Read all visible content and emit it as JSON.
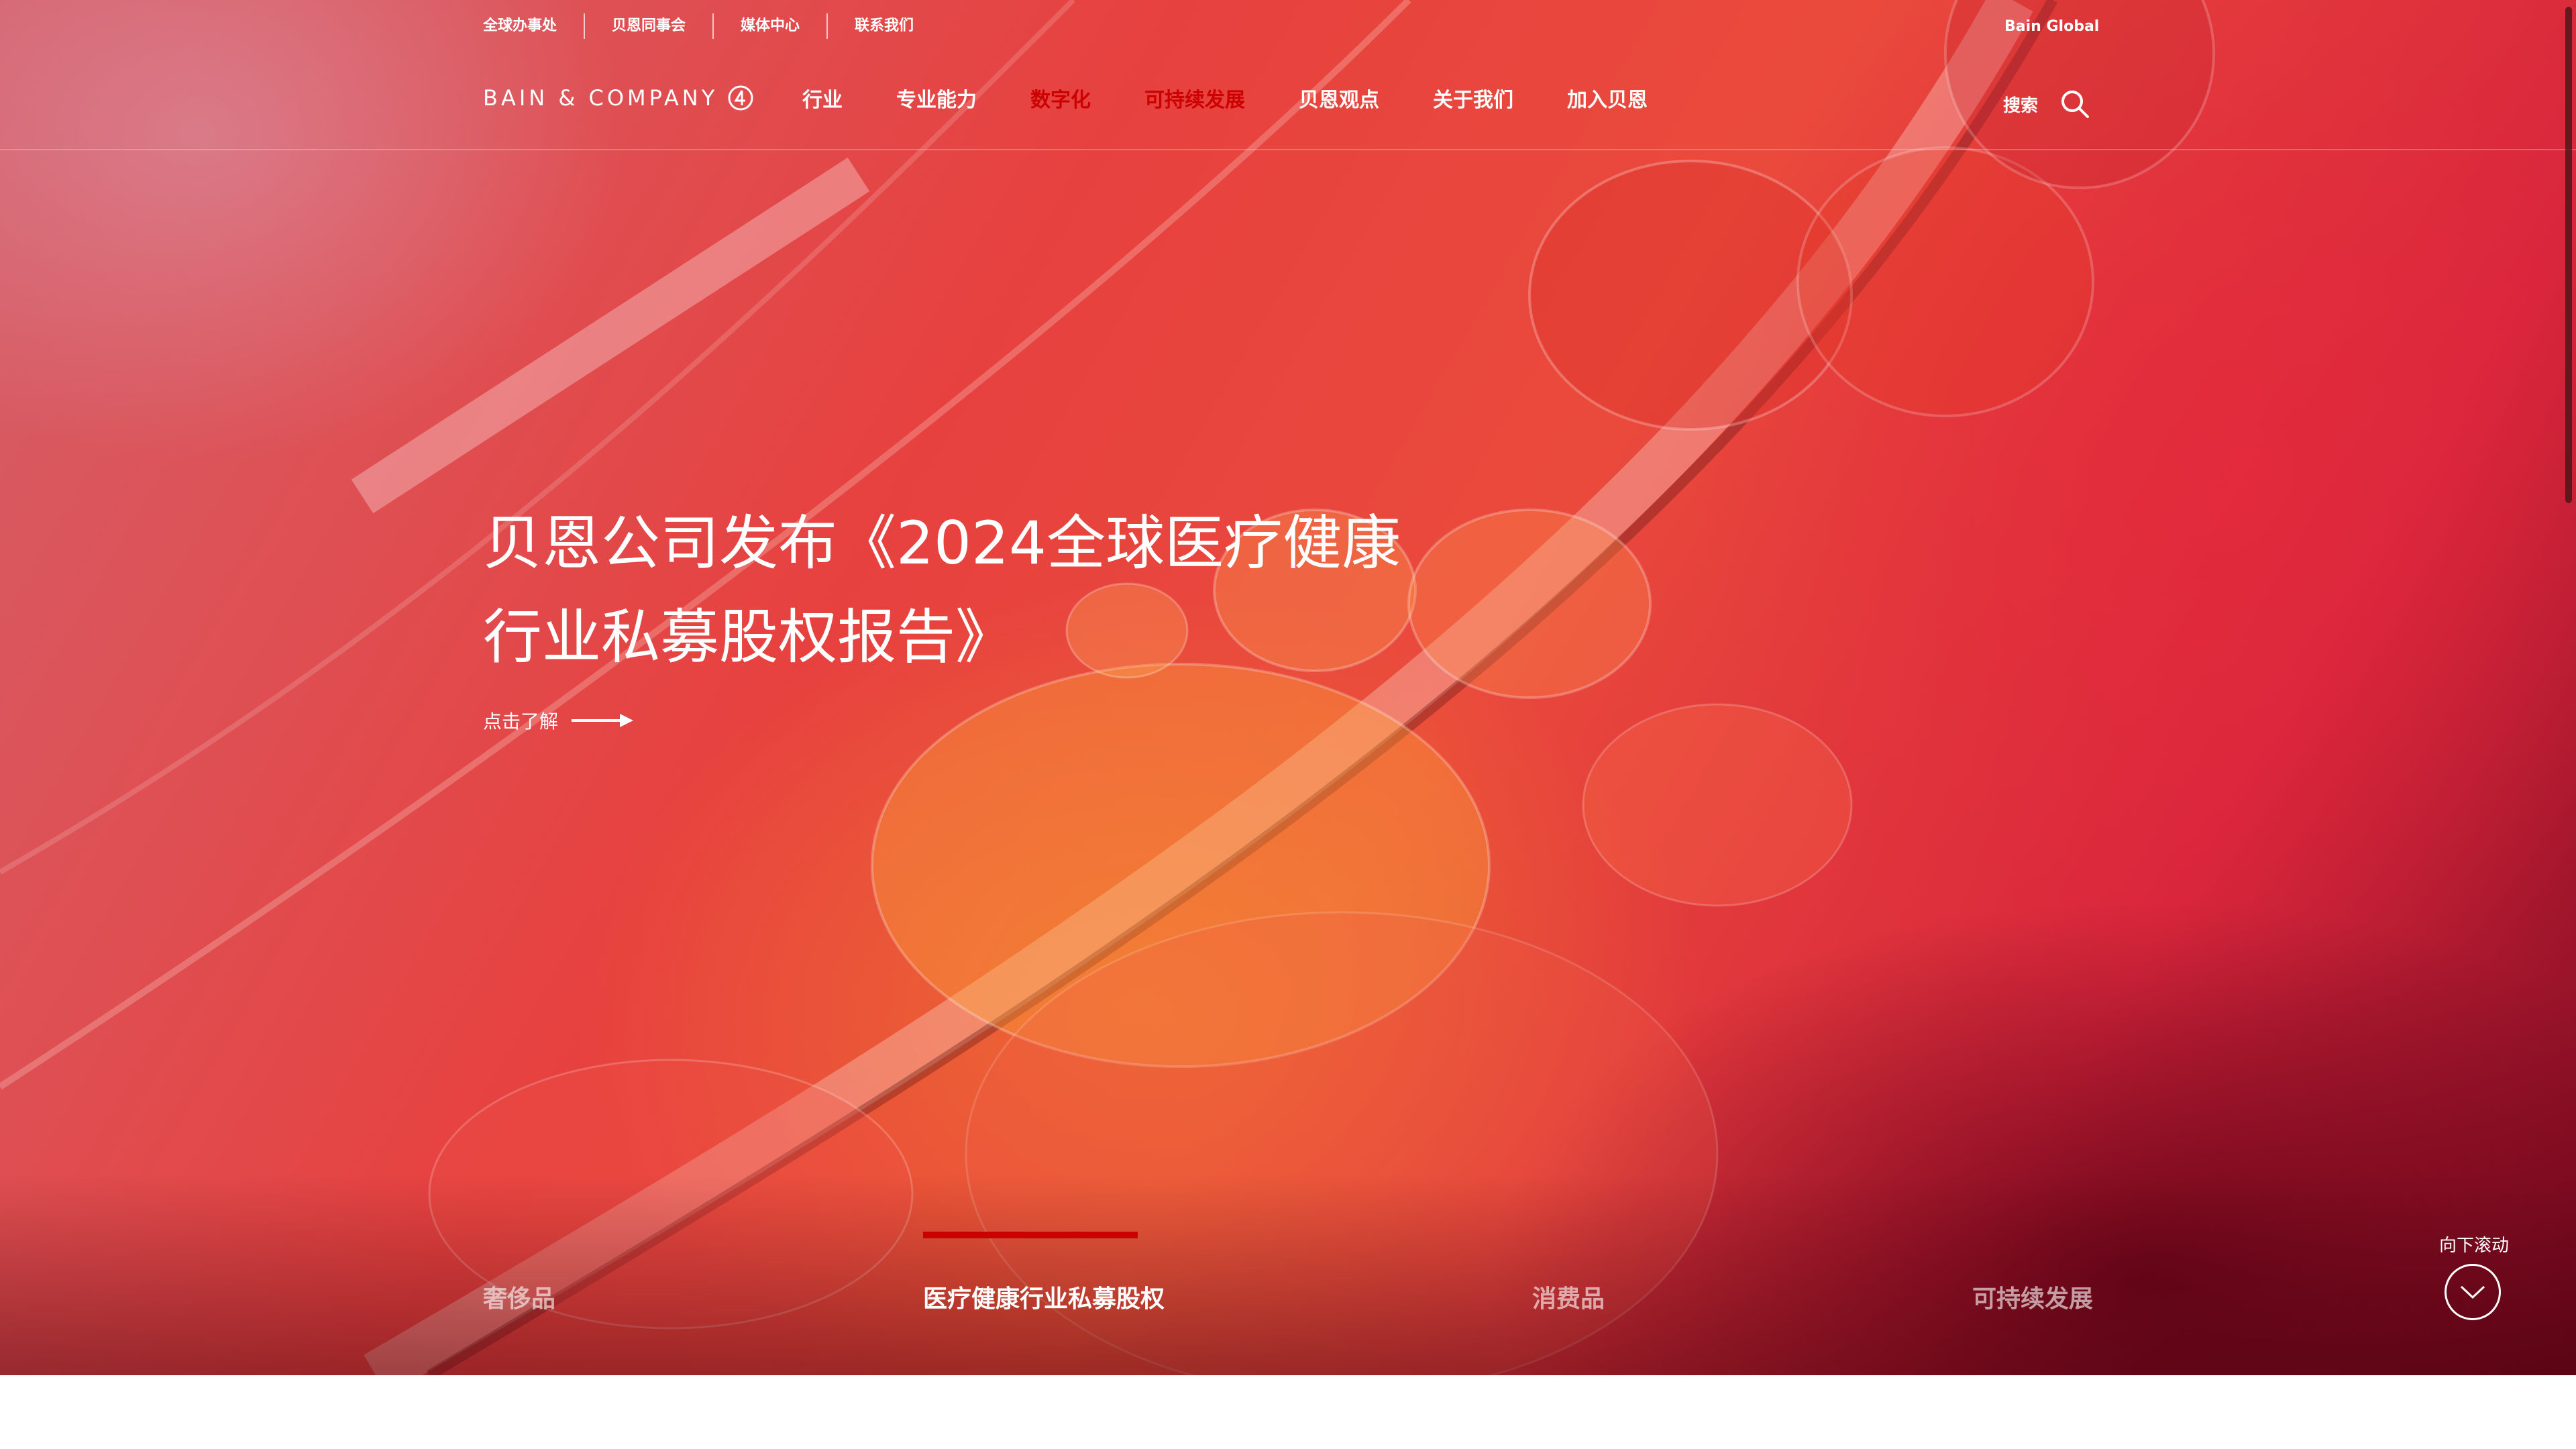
{
  "utility_nav": {
    "items": [
      "全球办事处",
      "贝恩同事会",
      "媒体中心",
      "联系我们"
    ],
    "bain_global": "Bain Global"
  },
  "brand": {
    "logo_text": "BAIN & COMPANY"
  },
  "main_nav": {
    "items": [
      "行业",
      "专业能力",
      "数字化",
      "可持续发展",
      "贝恩观点",
      "关于我们",
      "加入贝恩"
    ],
    "highlight_color": "#cc0000"
  },
  "search": {
    "label": "搜索"
  },
  "hero": {
    "headline_line1": "贝恩公司发布《2024全球医疗健康",
    "headline_line2": "行业私募股权报告》",
    "cta_label": "点击了解"
  },
  "carousel": {
    "tabs": [
      "奢侈品",
      "医疗健康行业私募股权",
      "消费品",
      "可持续发展"
    ],
    "active_index": 1
  },
  "scroll": {
    "label": "向下滚动"
  },
  "colors": {
    "accent": "#cc0000",
    "hero_base": "#e7413f"
  }
}
